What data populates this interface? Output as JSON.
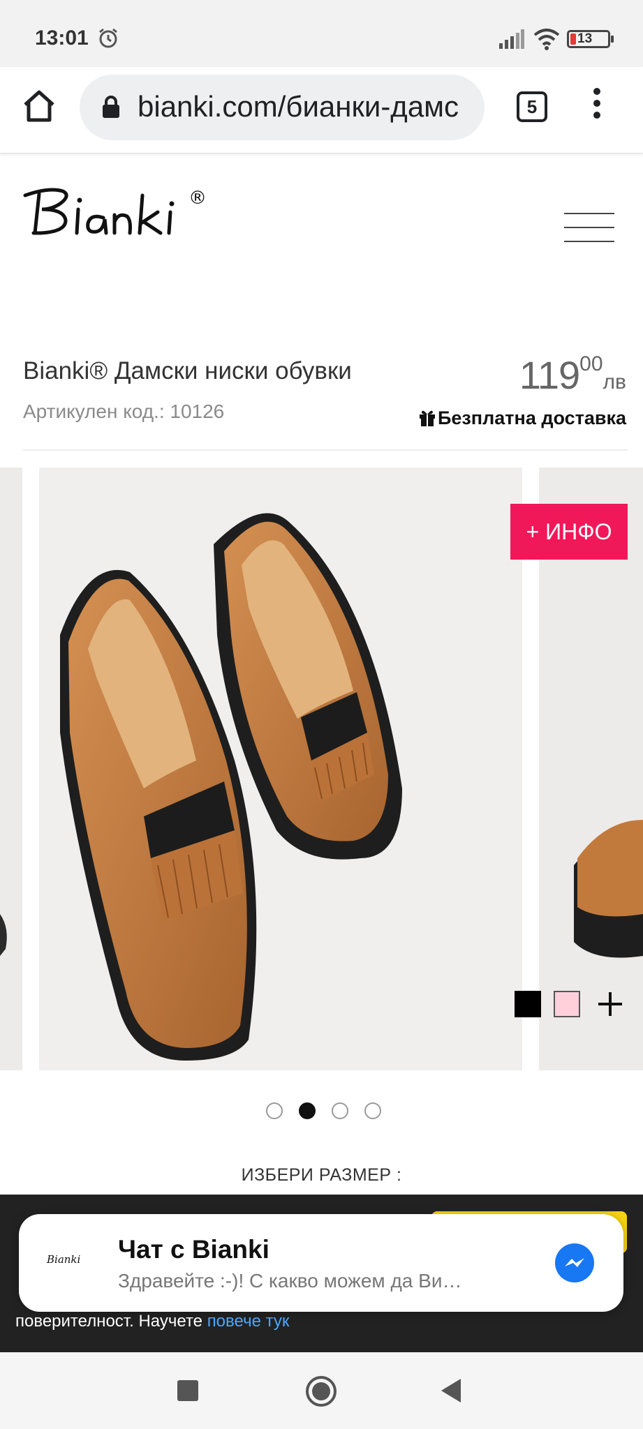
{
  "status_bar": {
    "time": "13:01",
    "battery": "13"
  },
  "browser": {
    "url": "bianki.com/бианки-дамс",
    "tab_count": "5"
  },
  "site": {
    "brand": "Bianki",
    "registered": "®"
  },
  "product": {
    "title": "Bianki® Дамски ниски обувки",
    "code": "Артикулен код.: 10126",
    "price_int": "119",
    "price_dec": "00",
    "currency": "лв",
    "delivery": "Безплатна доставка",
    "info_button": "+ ИНФО",
    "colors": [
      "#000000",
      "#ffd0dc"
    ],
    "carousel": {
      "slides": 4,
      "active": 2
    },
    "size_label": "ИЗБЕРИ РАЗМЕР :"
  },
  "cookie": {
    "text": "поверителност. Научете",
    "link": "повече тук"
  },
  "chat": {
    "title": "Чат с Bianki",
    "message": "Здравейте :-)! С какво можем да Ви…",
    "avatar_text": "Bianki"
  }
}
